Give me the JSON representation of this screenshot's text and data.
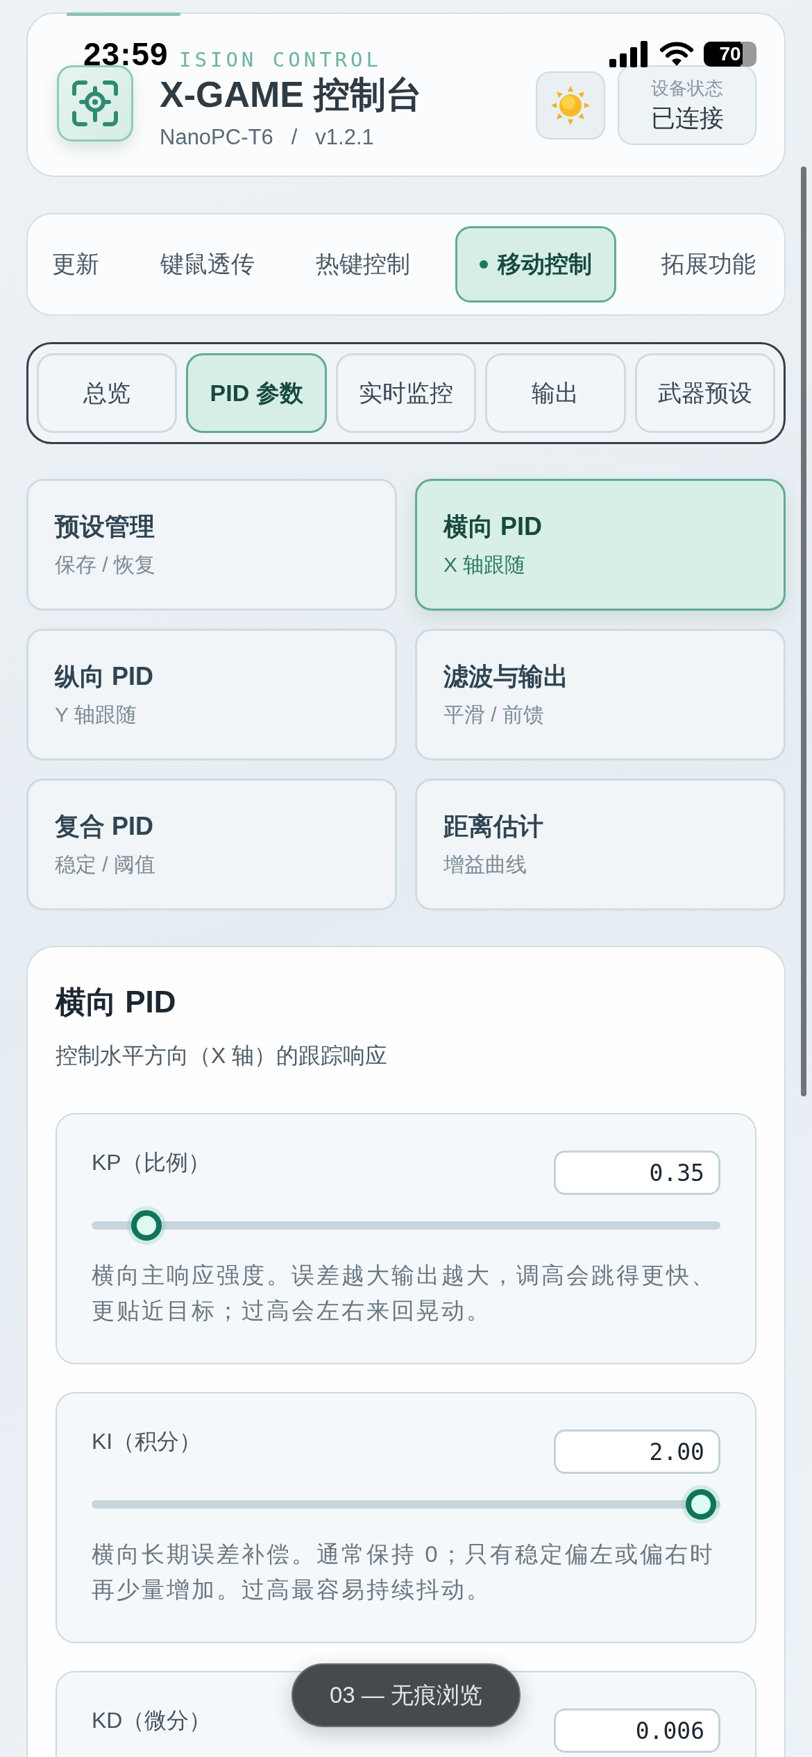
{
  "status_bar": {
    "time": "23:59",
    "battery": "70"
  },
  "header": {
    "eyebrow": "ISION CONTROL",
    "title": "X-GAME 控制台",
    "device": "NanoPC-T6",
    "separator": "/",
    "version": "v1.2.1",
    "status_label": "设备状态",
    "status_value": "已连接"
  },
  "tabs": [
    {
      "label": "更新",
      "selected": false
    },
    {
      "label": "键鼠透传",
      "selected": false
    },
    {
      "label": "热键控制",
      "selected": false
    },
    {
      "label": "移动控制",
      "selected": true
    },
    {
      "label": "拓展功能",
      "selected": false
    }
  ],
  "subtabs": [
    {
      "label": "总览",
      "selected": false
    },
    {
      "label": "PID 参数",
      "selected": true
    },
    {
      "label": "实时监控",
      "selected": false
    },
    {
      "label": "输出",
      "selected": false
    },
    {
      "label": "武器预设",
      "selected": false
    }
  ],
  "sections": [
    {
      "title": "预设管理",
      "subtitle": "保存 / 恢复",
      "selected": false
    },
    {
      "title": "横向 PID",
      "subtitle": "X 轴跟随",
      "selected": true
    },
    {
      "title": "纵向 PID",
      "subtitle": "Y 轴跟随",
      "selected": false
    },
    {
      "title": "滤波与输出",
      "subtitle": "平滑 / 前馈",
      "selected": false
    },
    {
      "title": "复合 PID",
      "subtitle": "稳定 / 阈值",
      "selected": false
    },
    {
      "title": "距离估计",
      "subtitle": "增益曲线",
      "selected": false
    }
  ],
  "panel": {
    "title": "横向 PID",
    "description": "控制水平方向（X 轴）的跟踪响应",
    "params": [
      {
        "label": "KP（比例）",
        "value": "0.35",
        "level": 0.06,
        "description": "横向主响应强度。误差越大输出越大，调高会跳得更快、更贴近目标；过高会左右来回晃动。"
      },
      {
        "label": "KI（积分）",
        "value": "2.00",
        "level": 1,
        "description": "横向长期误差补偿。通常保持 0；只有稳定偏左或偏右时再少量增加。过高最容易持续抖动。"
      },
      {
        "label": "KD（微分）",
        "value": "0.006"
      }
    ]
  },
  "toast": {
    "text": "03 — 无痕浏览"
  }
}
